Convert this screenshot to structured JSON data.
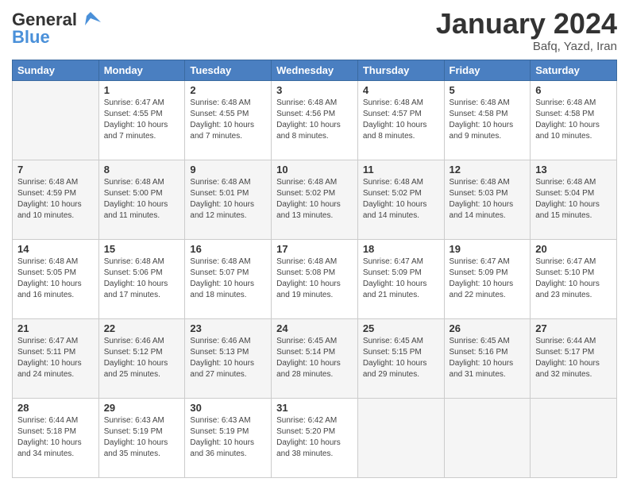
{
  "logo": {
    "line1": "General",
    "line2": "Blue"
  },
  "header": {
    "month": "January 2024",
    "location": "Bafq, Yazd, Iran"
  },
  "weekdays": [
    "Sunday",
    "Monday",
    "Tuesday",
    "Wednesday",
    "Thursday",
    "Friday",
    "Saturday"
  ],
  "weeks": [
    [
      {
        "day": "",
        "info": ""
      },
      {
        "day": "1",
        "info": "Sunrise: 6:47 AM\nSunset: 4:55 PM\nDaylight: 10 hours\nand 7 minutes."
      },
      {
        "day": "2",
        "info": "Sunrise: 6:48 AM\nSunset: 4:55 PM\nDaylight: 10 hours\nand 7 minutes."
      },
      {
        "day": "3",
        "info": "Sunrise: 6:48 AM\nSunset: 4:56 PM\nDaylight: 10 hours\nand 8 minutes."
      },
      {
        "day": "4",
        "info": "Sunrise: 6:48 AM\nSunset: 4:57 PM\nDaylight: 10 hours\nand 8 minutes."
      },
      {
        "day": "5",
        "info": "Sunrise: 6:48 AM\nSunset: 4:58 PM\nDaylight: 10 hours\nand 9 minutes."
      },
      {
        "day": "6",
        "info": "Sunrise: 6:48 AM\nSunset: 4:58 PM\nDaylight: 10 hours\nand 10 minutes."
      }
    ],
    [
      {
        "day": "7",
        "info": "Sunrise: 6:48 AM\nSunset: 4:59 PM\nDaylight: 10 hours\nand 10 minutes."
      },
      {
        "day": "8",
        "info": "Sunrise: 6:48 AM\nSunset: 5:00 PM\nDaylight: 10 hours\nand 11 minutes."
      },
      {
        "day": "9",
        "info": "Sunrise: 6:48 AM\nSunset: 5:01 PM\nDaylight: 10 hours\nand 12 minutes."
      },
      {
        "day": "10",
        "info": "Sunrise: 6:48 AM\nSunset: 5:02 PM\nDaylight: 10 hours\nand 13 minutes."
      },
      {
        "day": "11",
        "info": "Sunrise: 6:48 AM\nSunset: 5:02 PM\nDaylight: 10 hours\nand 14 minutes."
      },
      {
        "day": "12",
        "info": "Sunrise: 6:48 AM\nSunset: 5:03 PM\nDaylight: 10 hours\nand 14 minutes."
      },
      {
        "day": "13",
        "info": "Sunrise: 6:48 AM\nSunset: 5:04 PM\nDaylight: 10 hours\nand 15 minutes."
      }
    ],
    [
      {
        "day": "14",
        "info": "Sunrise: 6:48 AM\nSunset: 5:05 PM\nDaylight: 10 hours\nand 16 minutes."
      },
      {
        "day": "15",
        "info": "Sunrise: 6:48 AM\nSunset: 5:06 PM\nDaylight: 10 hours\nand 17 minutes."
      },
      {
        "day": "16",
        "info": "Sunrise: 6:48 AM\nSunset: 5:07 PM\nDaylight: 10 hours\nand 18 minutes."
      },
      {
        "day": "17",
        "info": "Sunrise: 6:48 AM\nSunset: 5:08 PM\nDaylight: 10 hours\nand 19 minutes."
      },
      {
        "day": "18",
        "info": "Sunrise: 6:47 AM\nSunset: 5:09 PM\nDaylight: 10 hours\nand 21 minutes."
      },
      {
        "day": "19",
        "info": "Sunrise: 6:47 AM\nSunset: 5:09 PM\nDaylight: 10 hours\nand 22 minutes."
      },
      {
        "day": "20",
        "info": "Sunrise: 6:47 AM\nSunset: 5:10 PM\nDaylight: 10 hours\nand 23 minutes."
      }
    ],
    [
      {
        "day": "21",
        "info": "Sunrise: 6:47 AM\nSunset: 5:11 PM\nDaylight: 10 hours\nand 24 minutes."
      },
      {
        "day": "22",
        "info": "Sunrise: 6:46 AM\nSunset: 5:12 PM\nDaylight: 10 hours\nand 25 minutes."
      },
      {
        "day": "23",
        "info": "Sunrise: 6:46 AM\nSunset: 5:13 PM\nDaylight: 10 hours\nand 27 minutes."
      },
      {
        "day": "24",
        "info": "Sunrise: 6:45 AM\nSunset: 5:14 PM\nDaylight: 10 hours\nand 28 minutes."
      },
      {
        "day": "25",
        "info": "Sunrise: 6:45 AM\nSunset: 5:15 PM\nDaylight: 10 hours\nand 29 minutes."
      },
      {
        "day": "26",
        "info": "Sunrise: 6:45 AM\nSunset: 5:16 PM\nDaylight: 10 hours\nand 31 minutes."
      },
      {
        "day": "27",
        "info": "Sunrise: 6:44 AM\nSunset: 5:17 PM\nDaylight: 10 hours\nand 32 minutes."
      }
    ],
    [
      {
        "day": "28",
        "info": "Sunrise: 6:44 AM\nSunset: 5:18 PM\nDaylight: 10 hours\nand 34 minutes."
      },
      {
        "day": "29",
        "info": "Sunrise: 6:43 AM\nSunset: 5:19 PM\nDaylight: 10 hours\nand 35 minutes."
      },
      {
        "day": "30",
        "info": "Sunrise: 6:43 AM\nSunset: 5:19 PM\nDaylight: 10 hours\nand 36 minutes."
      },
      {
        "day": "31",
        "info": "Sunrise: 6:42 AM\nSunset: 5:20 PM\nDaylight: 10 hours\nand 38 minutes."
      },
      {
        "day": "",
        "info": ""
      },
      {
        "day": "",
        "info": ""
      },
      {
        "day": "",
        "info": ""
      }
    ]
  ]
}
